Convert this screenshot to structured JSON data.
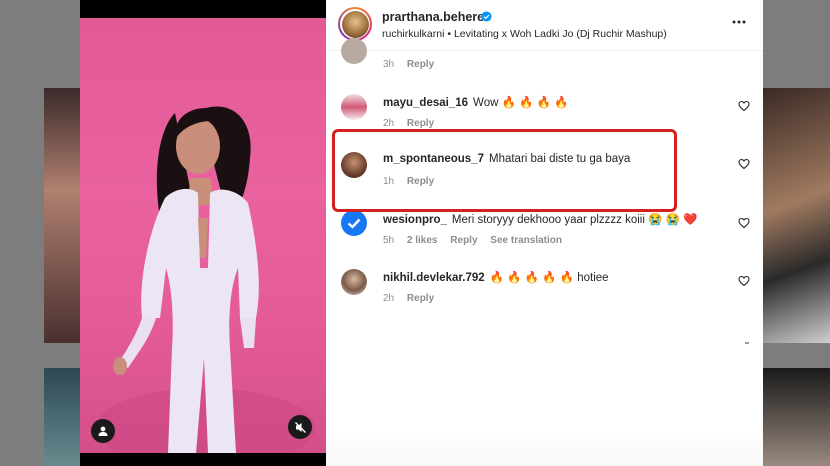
{
  "post": {
    "username": "prarthana.behere",
    "subtitle": "ruchirkulkarni • Levitating x Woh Ladki Jo (Dj Ruchir Mashup)"
  },
  "comments": [
    {
      "user": "",
      "text": "",
      "time": "3h",
      "reply": "Reply"
    },
    {
      "user": "mayu_desai_16",
      "text": "Wow 🔥 🔥 🔥 🔥",
      "time": "2h",
      "reply": "Reply"
    },
    {
      "user": "m_spontaneous_7",
      "text": "Mhatari bai diste tu ga baya",
      "time": "1h",
      "reply": "Reply"
    },
    {
      "user": "wesionpro_",
      "text": "Meri storyyy dekhooo yaar plzzzz koiii 😭 😭 ❤️",
      "time": "5h",
      "likes": "2 likes",
      "reply": "Reply",
      "translate": "See translation"
    },
    {
      "user": "nikhil.devlekar.792",
      "text": "🔥 🔥 🔥 🔥 🔥 hotiee",
      "time": "2h",
      "reply": "Reply"
    }
  ],
  "colors": {
    "highlight": "#d6201f",
    "verified": "#0095f6",
    "background": "#e5609c"
  },
  "icons": [
    "verified-badge-icon",
    "more-options-icon",
    "heart-icon",
    "user-tag-icon",
    "mute-icon"
  ]
}
